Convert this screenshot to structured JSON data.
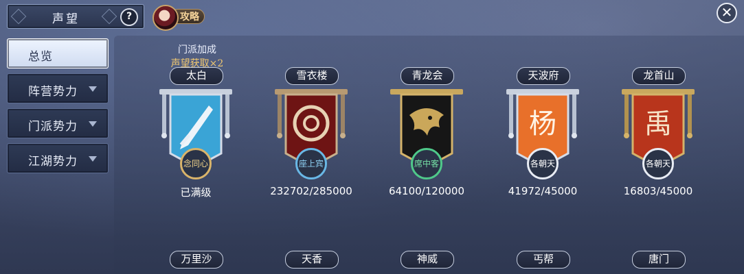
{
  "header": {
    "title": "声望",
    "help_icon": "?",
    "guide_label": "攻略",
    "close_icon": "✕"
  },
  "sidebar": {
    "items": [
      {
        "label": "总览",
        "active": true
      },
      {
        "label": "阵营势力",
        "active": false
      },
      {
        "label": "门派势力",
        "active": false
      },
      {
        "label": "江湖势力",
        "active": false
      }
    ]
  },
  "bonus": {
    "line1": "门派加成",
    "line2": "声望获取×2"
  },
  "factions": [
    {
      "name": "太白",
      "rank": "念同心",
      "progress_text": "已满级",
      "progress": 1.0,
      "banner_color": "#3aa4d6",
      "frame": "silver",
      "emblem": "sword-icon",
      "badge_text_color": "#f3d48b",
      "ring": "#d9b46a"
    },
    {
      "name": "雪衣楼",
      "rank": "座上宾",
      "progress_text": "232702/285000",
      "progress": 0.816,
      "banner_color": "#6e1414",
      "frame": "bronze",
      "emblem": "ring-icon",
      "badge_text_color": "#8fd2f5",
      "ring": "#69b8e6"
    },
    {
      "name": "青龙会",
      "rank": "席中客",
      "progress_text": "64100/120000",
      "progress": 0.534,
      "banner_color": "#1a1a1a",
      "frame": "gold",
      "emblem": "dragon-icon",
      "badge_text_color": "#76e0a6",
      "ring": "#4fc98a"
    },
    {
      "name": "天波府",
      "rank": "各朝天",
      "progress_text": "41972/45000",
      "progress": 0.933,
      "banner_color": "#e8702a",
      "frame": "silver",
      "emblem": "yang-glyph-icon",
      "badge_text_color": "#ffffff",
      "ring": "#e8ecf4"
    },
    {
      "name": "龙首山",
      "rank": "各朝天",
      "progress_text": "16803/45000",
      "progress": 0.373,
      "banner_color": "#b8351c",
      "frame": "gold",
      "emblem": "seal-glyph-icon",
      "badge_text_color": "#ffffff",
      "ring": "#e8ecf4"
    }
  ],
  "factions_row2": [
    {
      "name": "万里沙"
    },
    {
      "name": "天香"
    },
    {
      "name": "神威"
    },
    {
      "name": "丐帮"
    },
    {
      "name": "唐门"
    }
  ],
  "glyphs": {
    "yang": "杨",
    "seal": "禹"
  }
}
